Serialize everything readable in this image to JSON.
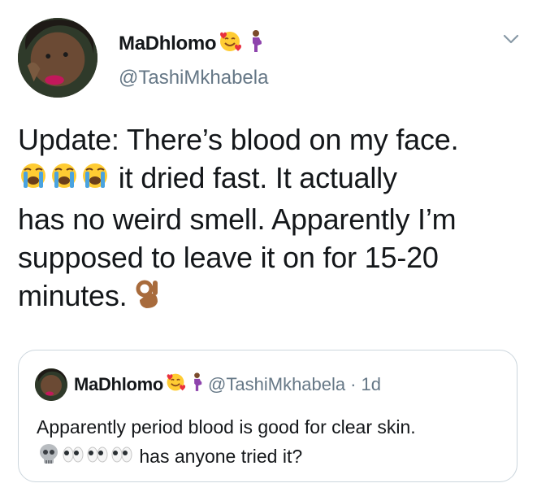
{
  "tweet": {
    "display_name": "MaDhlomo",
    "name_emojis": [
      "smiling-face-with-hearts",
      "pregnant-woman"
    ],
    "handle": "@TashiMkhabela",
    "text_lines": [
      "Update: There’s blood on my face.",
      " it dried fast. It actually",
      "has no weird smell. Apparently I’m",
      "supposed to leave it on for 15-20",
      "minutes. "
    ],
    "text_emojis": [
      "loudly-crying-face",
      "loudly-crying-face",
      "loudly-crying-face",
      "ok-hand"
    ]
  },
  "quoted_tweet": {
    "display_name": "MaDhlomo",
    "handle": "@TashiMkhabela",
    "separator": "·",
    "time": "1d",
    "text_lines": [
      "Apparently period blood is good for clear skin.",
      " has anyone tried it?"
    ],
    "text_emojis": [
      "skull",
      "eyes",
      "eyes",
      "eyes"
    ]
  },
  "colors": {
    "primary_text": "#14171a",
    "secondary_text": "#657786",
    "border": "#ccd6dd"
  }
}
